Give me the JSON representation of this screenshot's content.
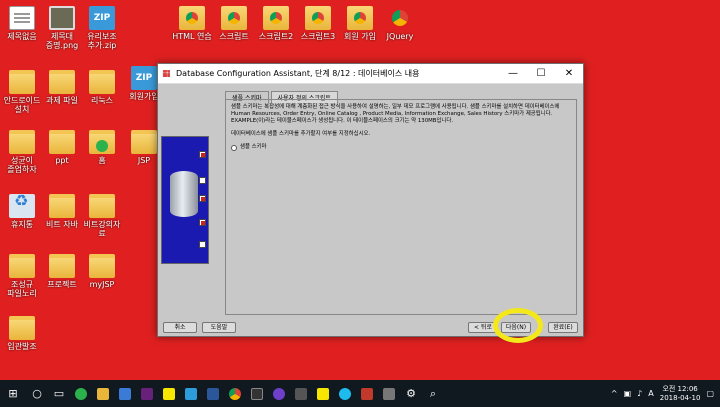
{
  "desktop_icons": [
    {
      "label": "제목없음",
      "glyph": "doc-icon",
      "col": 0,
      "row": 0
    },
    {
      "label": "제목대\n증명.png",
      "glyph": "photo-icon",
      "col": 1,
      "row": 0
    },
    {
      "label": "유리보조\n추가.zip",
      "glyph": "zip-icon",
      "col": 2,
      "row": 0
    },
    {
      "label": "HTML 연습",
      "glyph": "chrome-folder-icon"
    },
    {
      "label": "스크립트",
      "glyph": "chrome-folder-icon"
    },
    {
      "label": "스크립트2",
      "glyph": "chrome-folder-icon"
    },
    {
      "label": "스크립트3",
      "glyph": "chrome-folder-icon"
    },
    {
      "label": "회원 가입",
      "glyph": "chrome-folder-icon"
    },
    {
      "label": "JQuery",
      "glyph": "chrome-icon"
    },
    {
      "label": "안드로이드\n설치",
      "glyph": "folder-icon"
    },
    {
      "label": "과제 파일",
      "glyph": "folder-icon"
    },
    {
      "label": "리눅스",
      "glyph": "folder-icon"
    },
    {
      "label": "회원가입",
      "glyph": "zip-icon"
    },
    {
      "label": "성균이\n졸업하자",
      "glyph": "folder-icon"
    },
    {
      "label": "ppt",
      "glyph": "folder-icon"
    },
    {
      "label": "홈",
      "glyph": "folder-icon"
    },
    {
      "label": "JSP",
      "glyph": "folder-icon"
    },
    {
      "label": "휴지통",
      "glyph": "recycle-icon"
    },
    {
      "label": "비트 자바",
      "glyph": "folder-icon"
    },
    {
      "label": "비트강의자료",
      "glyph": "folder-icon"
    },
    {
      "label": "조성규\n파일노리",
      "glyph": "folder-icon"
    },
    {
      "label": "프로젝트",
      "glyph": "folder-icon"
    },
    {
      "label": "myJSP",
      "glyph": "folder-icon"
    },
    {
      "label": "입관발조",
      "glyph": "folder-icon"
    }
  ],
  "window": {
    "title": "Database Configuration Assistant, 단계 8/12 : 데이터베이스 내용",
    "minimize": "—",
    "maximize": "☐",
    "close": "✕",
    "tabs": [
      "샘플 스키마",
      "사용자 정의 스크립트"
    ],
    "description": "샘플 스키마는 복잡성에 대해 계층화된 접근 방식을 사용하여 설명하는, 일부 데모 프로그램에 사용됩니다. 샘플 스키마를 설치하면 데이터베이스에 Human Resources, Order Entry, Online Catalog , Product Media, Information Exchange, Sales History 스키마가 제공됩니다. EXAMPLE(이)라는 테이블스페이스가 생성됩니다. 이 테이블스페이스의 크기는 약 130MB입니다.",
    "question": "데이터베이스에 샘플 스키마를 추가할지 여부를 지정하십시오.",
    "option": "샘플 스키마",
    "buttons": {
      "cancel": "취소",
      "help": "도움말",
      "back": "< 뒤로",
      "next": "다음(N)",
      "finish": "완료(E)"
    }
  },
  "taskbar": {
    "clock_time": "오전 12:06",
    "clock_date": "2018-04-10",
    "ime": "A",
    "apps": [
      "start-icon",
      "search-icon",
      "task-view-icon",
      "green-app-icon",
      "folder-icon",
      "store-icon",
      "visual-studio-icon",
      "kakao-icon",
      "pen-icon",
      "word-icon",
      "chrome-icon",
      "terminal-icon",
      "github-icon",
      "film-icon",
      "sticky-icon",
      "ie-icon",
      "chart-icon",
      "phone-icon",
      "settings-icon",
      "search2-icon"
    ]
  },
  "colors": {
    "desktop": "#e02020",
    "taskbar": "#101820",
    "highlight": "#f5e81a"
  }
}
